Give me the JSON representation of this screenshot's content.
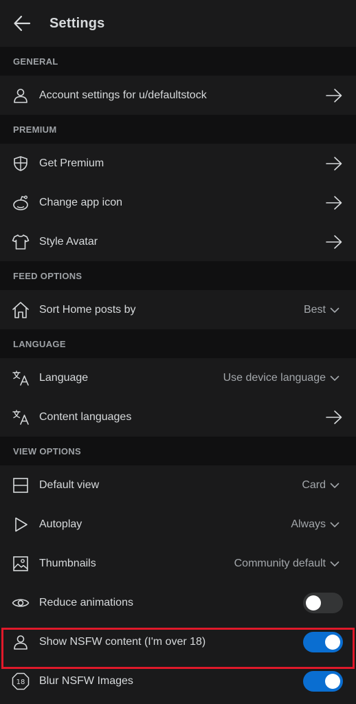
{
  "app_bar": {
    "title": "Settings",
    "back_icon": "arrow-left-icon"
  },
  "sections": {
    "general": {
      "header": "GENERAL",
      "account": {
        "label": "Account settings for u/defaultstock",
        "icon": "user-icon"
      }
    },
    "premium": {
      "header": "PREMIUM",
      "get_premium": {
        "label": "Get Premium",
        "icon": "shield-icon"
      },
      "change_icon": {
        "label": "Change app icon",
        "icon": "snoo-icon"
      },
      "style_avatar": {
        "label": "Style Avatar",
        "icon": "shirt-icon"
      }
    },
    "feed": {
      "header": "FEED OPTIONS",
      "sort_home": {
        "label": "Sort Home posts by",
        "value": "Best",
        "icon": "home-icon"
      }
    },
    "language": {
      "header": "LANGUAGE",
      "language": {
        "label": "Language",
        "value": "Use device language",
        "icon": "translate-icon"
      },
      "content_languages": {
        "label": "Content languages",
        "icon": "translate-icon"
      }
    },
    "view": {
      "header": "VIEW OPTIONS",
      "default_view": {
        "label": "Default view",
        "value": "Card",
        "icon": "layout-icon"
      },
      "autoplay": {
        "label": "Autoplay",
        "value": "Always",
        "icon": "play-icon"
      },
      "thumbnails": {
        "label": "Thumbnails",
        "value": "Community default",
        "icon": "image-icon"
      },
      "reduce_animations": {
        "label": "Reduce animations",
        "enabled": false,
        "icon": "eye-icon"
      },
      "show_nsfw": {
        "label": "Show NSFW content (I'm over 18)",
        "enabled": true,
        "icon": "user-icon"
      },
      "blur_nsfw": {
        "label": "Blur NSFW Images",
        "enabled": true,
        "icon": "age-18-icon"
      }
    }
  },
  "colors": {
    "background": "#1a1a1b",
    "section_background": "#101011",
    "toggle_on": "#0a6ed1",
    "toggle_off": "#343536",
    "highlight": "#e0192a"
  }
}
